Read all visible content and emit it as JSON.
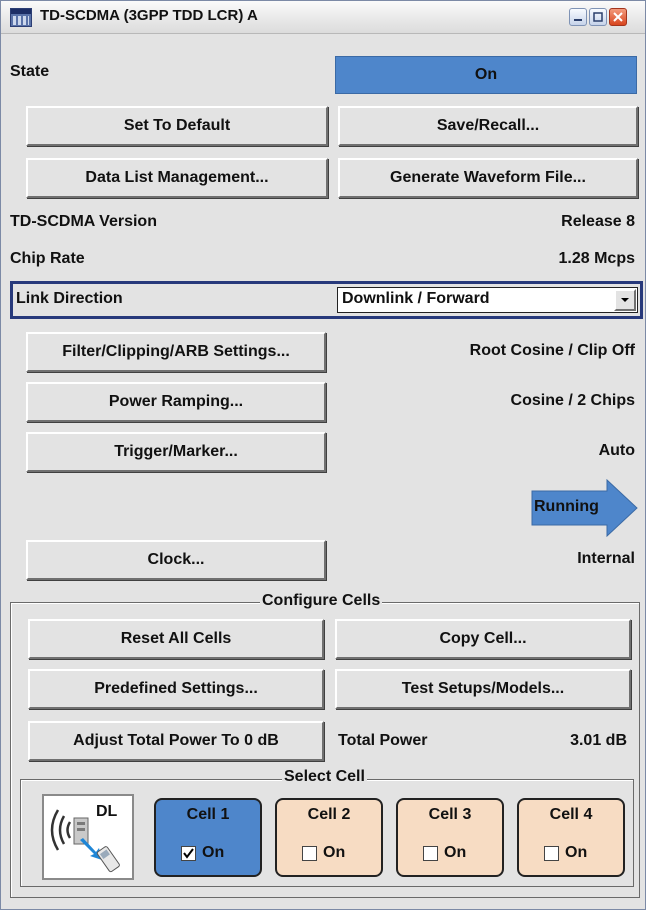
{
  "window": {
    "title": "TD-SCDMA (3GPP TDD LCR) A"
  },
  "state": {
    "label": "State",
    "value": "On"
  },
  "buttons": {
    "set_default": "Set To Default",
    "save_recall": "Save/Recall...",
    "data_list": "Data List Management...",
    "generate_waveform": "Generate Waveform File...",
    "filter": "Filter/Clipping/ARB Settings...",
    "power_ramping": "Power Ramping...",
    "trigger": "Trigger/Marker...",
    "clock": "Clock..."
  },
  "info": {
    "version_label": "TD-SCDMA Version",
    "version_value": "Release 8",
    "chip_rate_label": "Chip Rate",
    "chip_rate_value": "1.28 Mcps"
  },
  "link_direction": {
    "label": "Link Direction",
    "value": "Downlink / Forward"
  },
  "values": {
    "filter": "Root Cosine / Clip Off",
    "power_ramping": "Cosine /  2 Chips",
    "trigger": "Auto",
    "running": "Running",
    "clock": "Internal"
  },
  "configure_cells": {
    "title": "Configure Cells",
    "reset_all": "Reset All Cells",
    "copy_cell": "Copy Cell...",
    "predefined": "Predefined Settings...",
    "test_setups": "Test Setups/Models...",
    "adjust_power": "Adjust Total Power To 0 dB",
    "total_power_label": "Total Power",
    "total_power_value": "3.01 dB"
  },
  "select_cell": {
    "title": "Select Cell",
    "link_icon_text": "DL",
    "cells": [
      {
        "name": "Cell 1",
        "on_label": "On",
        "checked": true,
        "selected": true
      },
      {
        "name": "Cell 2",
        "on_label": "On",
        "checked": false,
        "selected": false
      },
      {
        "name": "Cell 3",
        "on_label": "On",
        "checked": false,
        "selected": false
      },
      {
        "name": "Cell 4",
        "on_label": "On",
        "checked": false,
        "selected": false
      }
    ]
  },
  "colors": {
    "active_blue": "#4e86cb",
    "cell_inactive": "#f7dcc3",
    "focus_border": "#27397b",
    "panel_bg": "#e3e3e3"
  }
}
